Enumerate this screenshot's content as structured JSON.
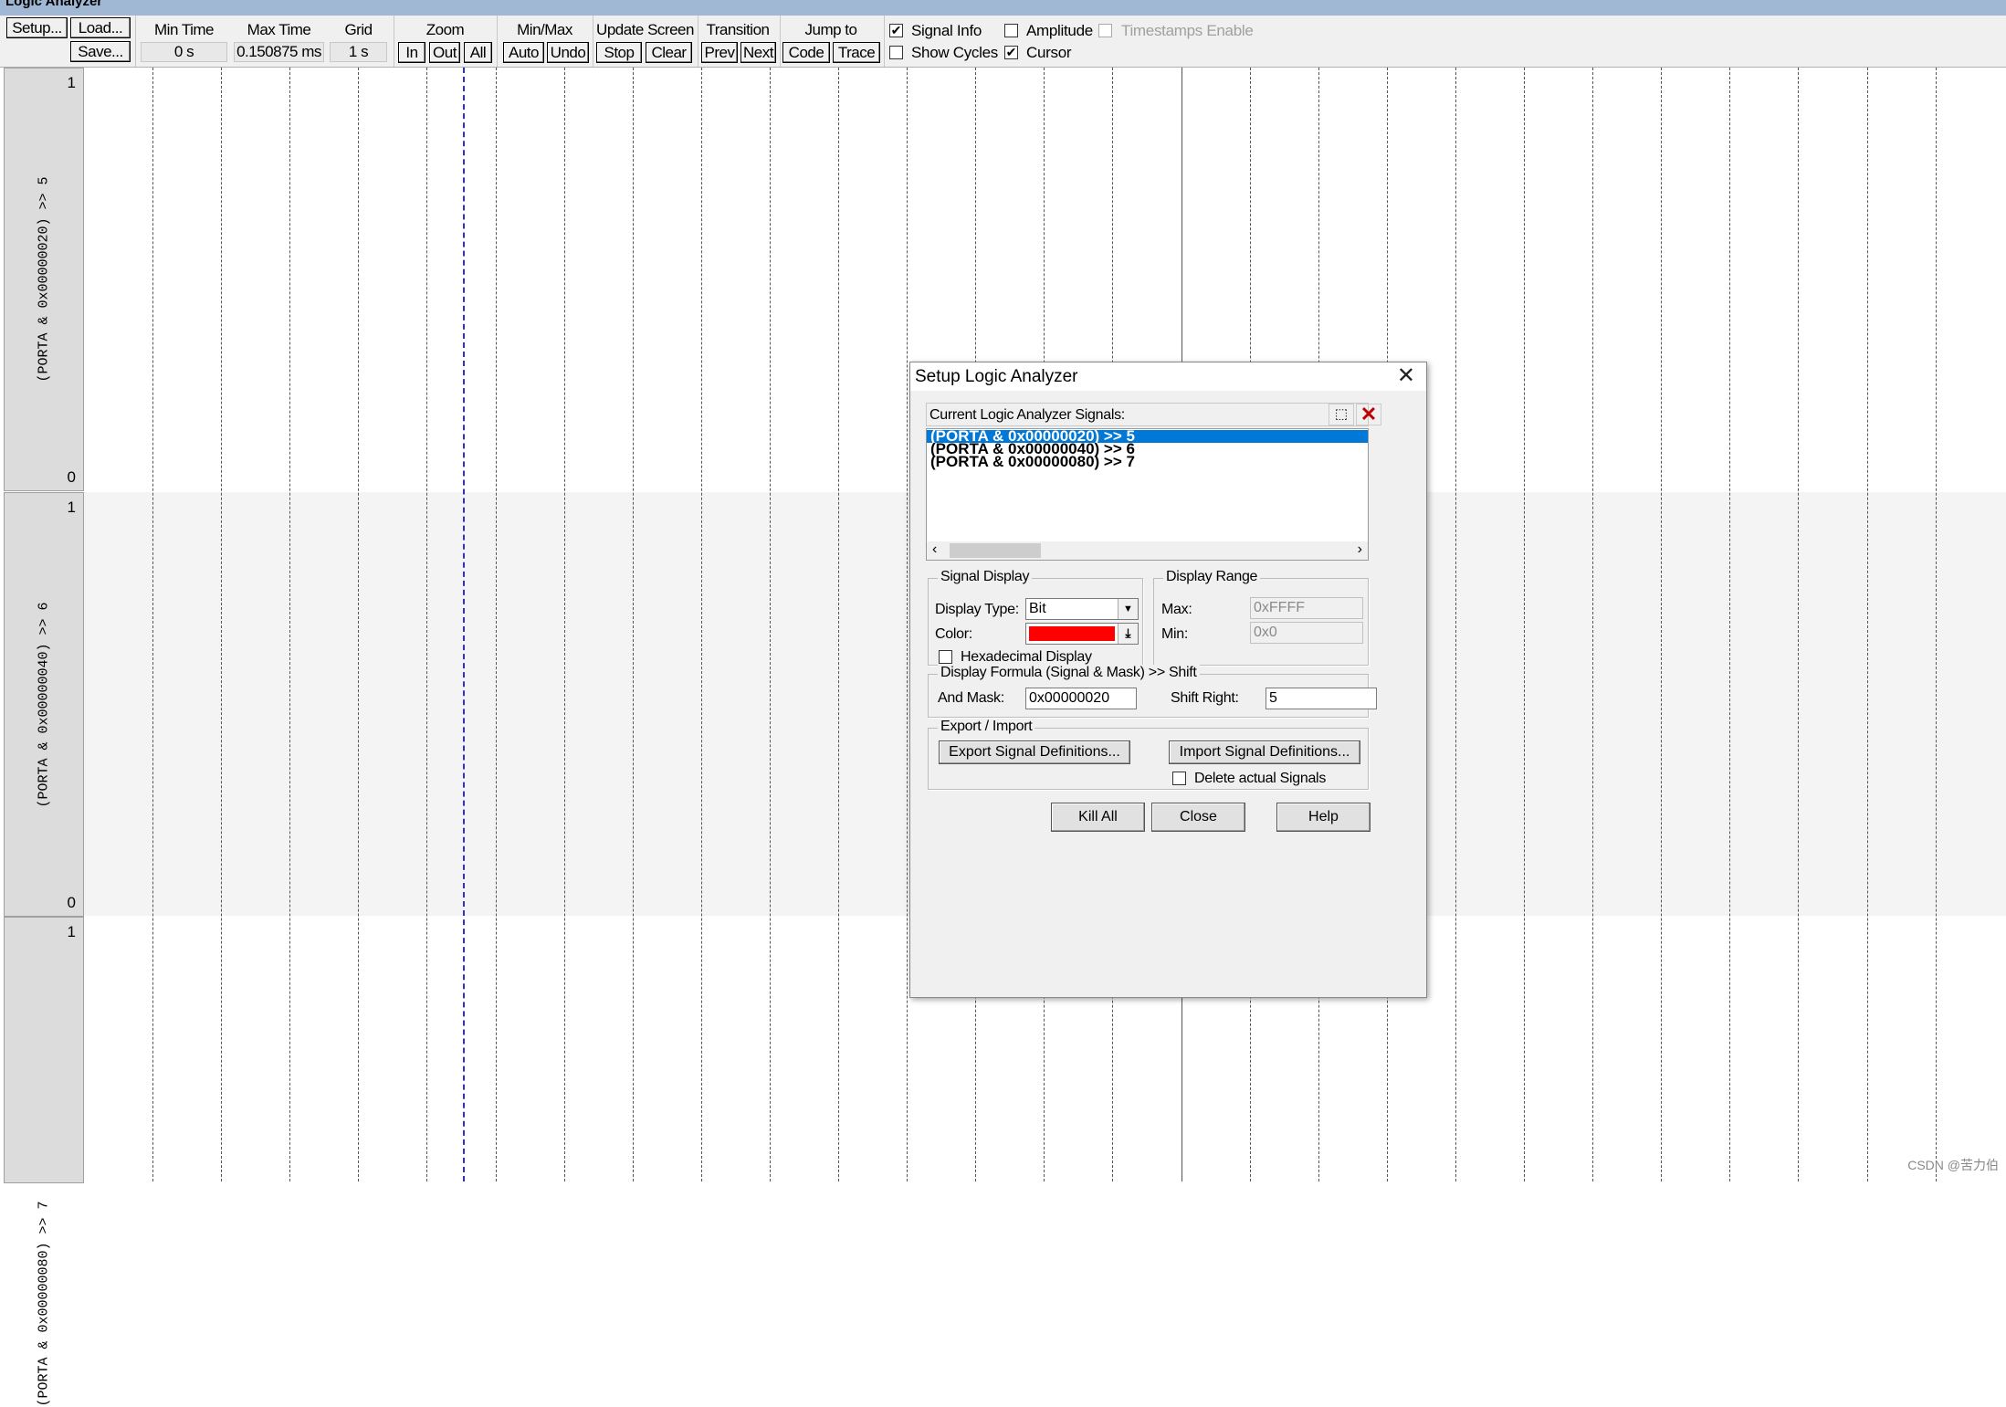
{
  "window": {
    "title": "Logic Analyzer"
  },
  "toolbar": {
    "setup": "Setup...",
    "load": "Load...",
    "save": "Save...",
    "min_time_label": "Min Time",
    "min_time": "0 s",
    "max_time_label": "Max Time",
    "max_time": "0.150875 ms",
    "grid_label": "Grid",
    "grid": "1 s",
    "zoom_label": "Zoom",
    "zoom_in": "In",
    "zoom_out": "Out",
    "zoom_all": "All",
    "minmax_label": "Min/Max",
    "auto": "Auto",
    "undo": "Undo",
    "update_label": "Update Screen",
    "stop": "Stop",
    "clear": "Clear",
    "transition_label": "Transition",
    "prev": "Prev",
    "next": "Next",
    "jump_label": "Jump to",
    "code": "Code",
    "trace": "Trace",
    "signal_info": {
      "label": "Signal Info",
      "checked": true
    },
    "amplitude": {
      "label": "Amplitude",
      "checked": false
    },
    "timestamps": {
      "label": "Timestamps Enable",
      "checked": false,
      "disabled": true
    },
    "show_cycles": {
      "label": "Show Cycles",
      "checked": false
    },
    "cursor": {
      "label": "Cursor",
      "checked": true
    }
  },
  "signals": [
    {
      "name": "(PORTA & 0x00000020) >> 5",
      "max": "1",
      "min": "0"
    },
    {
      "name": "(PORTA & 0x00000040) >> 6",
      "max": "1",
      "min": "0"
    },
    {
      "name": "(PORTA & 0x00000080) >> 7",
      "max": "1",
      "min": ""
    }
  ],
  "dialog": {
    "title": "Setup Logic Analyzer",
    "signals_header": "Current Logic Analyzer Signals:",
    "list": [
      "(PORTA & 0x00000020) >> 5",
      "(PORTA & 0x00000040) >> 6",
      "(PORTA & 0x00000080) >> 7"
    ],
    "selected_index": 0,
    "signal_display": {
      "title": "Signal Display",
      "display_type_label": "Display Type:",
      "display_type": "Bit",
      "color_label": "Color:",
      "color": "#ff0000",
      "hex_label": "Hexadecimal Display",
      "hex_checked": false
    },
    "display_range": {
      "title": "Display Range",
      "max_label": "Max:",
      "max": "0xFFFF",
      "min_label": "Min:",
      "min": "0x0"
    },
    "formula": {
      "title": "Display Formula (Signal & Mask) >> Shift",
      "mask_label": "And Mask:",
      "mask": "0x00000020",
      "shift_label": "Shift Right:",
      "shift": "5"
    },
    "export_import": {
      "title": "Export / Import",
      "export": "Export Signal Definitions...",
      "import": "Import Signal Definitions...",
      "delete_label": "Delete actual Signals",
      "delete_checked": false
    },
    "buttons": {
      "kill_all": "Kill All",
      "close": "Close",
      "help": "Help"
    }
  },
  "watermark": "CSDN @苦力伯",
  "colors": {
    "cursor": "#3030d0",
    "selection": "#0078d7",
    "titlebar": "#a0b8d4"
  }
}
